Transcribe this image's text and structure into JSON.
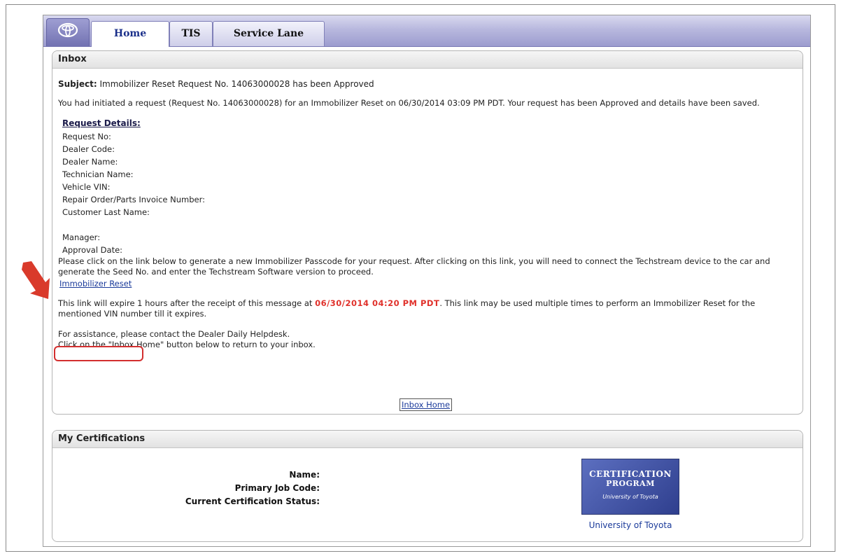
{
  "tabs": [
    {
      "label": "Home",
      "active": true
    },
    {
      "label": "TIS",
      "active": false
    },
    {
      "label": "Service Lane",
      "active": false
    }
  ],
  "inbox": {
    "title": "Inbox",
    "subject_label": "Subject:",
    "subject_text": "Immobilizer Reset Request No. 14063000028 has been Approved",
    "intro": "You had initiated a request (Request No. 14063000028) for an Immobilizer Reset on 06/30/2014 03:09 PM PDT. Your request has been Approved and details have been saved.",
    "request_details_title": "Request Details:",
    "details": [
      "Request No:",
      "Dealer Code:",
      "Dealer Name:",
      "Technician Name:",
      "Vehicle VIN:",
      "Repair Order/Parts Invoice Number:",
      "Customer Last Name:"
    ],
    "details2": [
      "Manager:",
      "Approval Date:"
    ],
    "click_instruction": "Please click on the link below to generate a new Immobilizer Passcode for your request. After clicking on this link, you will need to connect the Techstream device to the car and generate the Seed No. and enter the Techstream Software version to proceed.",
    "reset_link": "Immobilizer Reset",
    "expire_prefix": "This link will expire 1 hours after the receipt of this message at",
    "expire_time": "06/30/2014 04:20 PM PDT",
    "expire_suffix": ". This link may be used multiple times to perform an Immobilizer Reset for the mentioned VIN number till it expires.",
    "assist_line1": "For assistance, please contact the Dealer Daily Helpdesk.",
    "assist_line2": "Click on the \"Inbox Home\" button below to return to your inbox.",
    "inbox_home_button": "Inbox Home"
  },
  "certifications": {
    "title": "My Certifications",
    "labels": [
      "Name:",
      "Primary Job Code:",
      "Current Certification Status:"
    ],
    "logo_line1": "CERTIFICATION",
    "logo_line2": "PROGRAM",
    "logo_line3": "University of Toyota",
    "caption": "University of Toyota"
  },
  "colors": {
    "tab_bar": "#9c9ccf",
    "link": "#1a3a9a",
    "expire_time": "#e0312b",
    "highlight": "#d32f2f"
  },
  "icons": {
    "logo": "toyota-logo-icon",
    "arrow": "red-arrow-icon"
  }
}
